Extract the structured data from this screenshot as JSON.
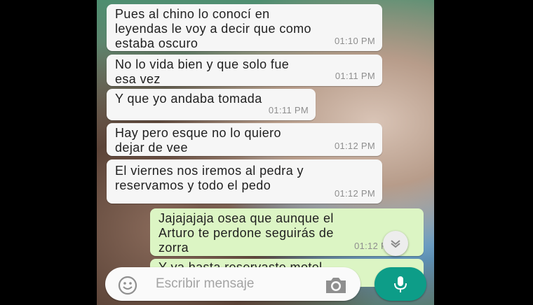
{
  "messages": [
    {
      "text": "Pues al chino lo conocí en\nleyendas le voy a decir que como\nestaba oscuro",
      "time": "01:10 PM",
      "direction": "incoming"
    },
    {
      "text": "No lo vida bien y que solo fue\nesa vez",
      "time": "01:11 PM",
      "direction": "incoming"
    },
    {
      "text": "Y que yo andaba tomada",
      "time": "01:11 PM",
      "direction": "incoming"
    },
    {
      "text": "Hay pero esque no lo quiero\ndejar de vee",
      "time": "01:12 PM",
      "direction": "incoming"
    },
    {
      "text": "El viernes nos iremos al pedra y\nreservamos y todo el pedo",
      "time": "01:12 PM",
      "direction": "incoming"
    },
    {
      "text": "Jajajajaja osea que aunque el\nArturo te perdone seguirás de\nzorra",
      "time": "01:12 P",
      "direction": "outgoing"
    }
  ],
  "peek_message": "Y ya hasta reservaste motel",
  "composer": {
    "placeholder": "Escribir mensaje"
  },
  "icons": {
    "emoji": "emoji-icon",
    "camera": "camera-icon",
    "mic": "microphone-icon",
    "scroll": "chevron-down-icon"
  },
  "colors": {
    "incoming_bubble": "#f6f6f6",
    "outgoing_bubble": "#dcf5c4",
    "accent": "#0d9d88"
  }
}
